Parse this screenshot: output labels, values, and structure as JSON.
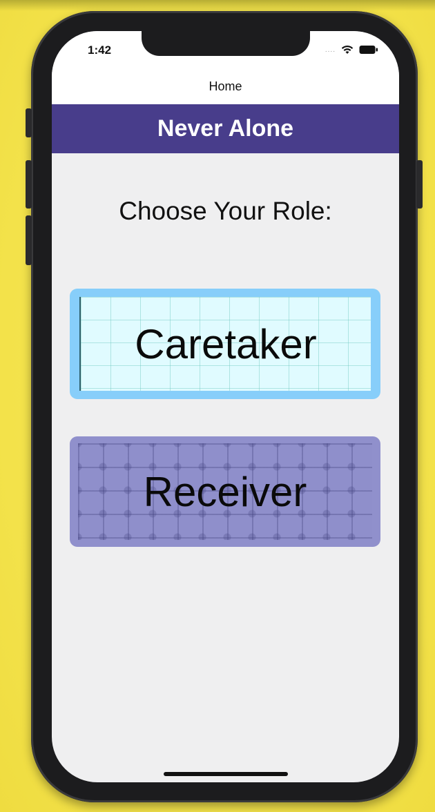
{
  "status_bar": {
    "time": "1:42",
    "signal_dots": "....",
    "wifi_icon": "wifi-icon",
    "battery_icon": "battery-icon"
  },
  "navigation": {
    "title": "Home"
  },
  "header": {
    "title": "Never Alone",
    "background_color": "#483d8b"
  },
  "main": {
    "prompt": "Choose Your Role:",
    "roles": [
      {
        "label": "Caretaker",
        "border_color": "#87cefa"
      },
      {
        "label": "Receiver",
        "background_color": "#9090cc"
      }
    ]
  }
}
